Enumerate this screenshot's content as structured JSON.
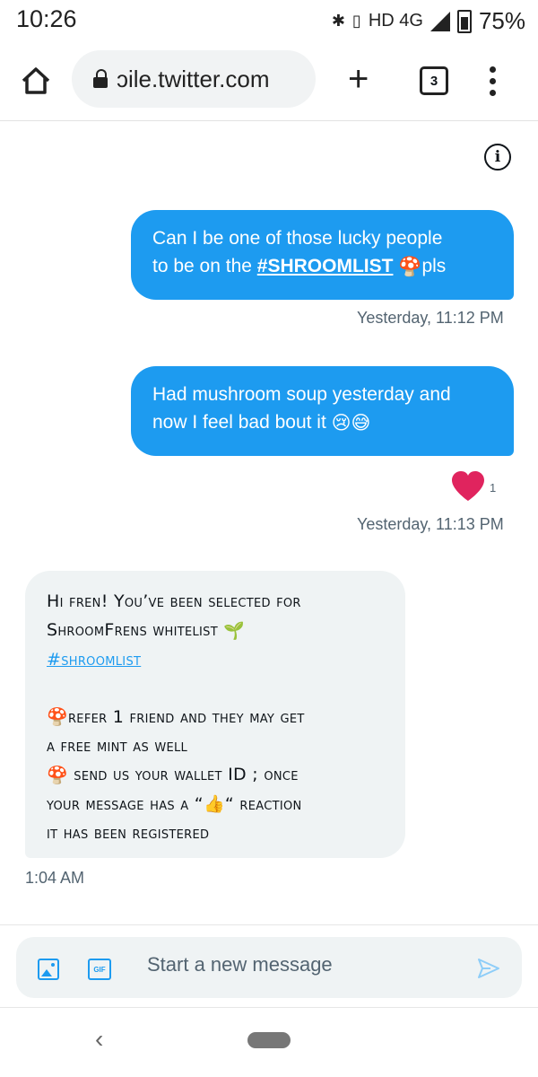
{
  "status_bar": {
    "time": "10:26",
    "network": "HD 4G",
    "battery": "75%"
  },
  "browser": {
    "url": "ɔile.twitter.com",
    "tab_count": "3"
  },
  "messages": [
    {
      "direction": "outgoing",
      "line1": "Can I be one of those lucky people",
      "line2_prefix": "to be on the ",
      "hashtag": "#SHROOMLIST",
      "emoji": "🍄",
      "line2_suffix": "pls",
      "timestamp": "Yesterday, 11:12 PM"
    },
    {
      "direction": "outgoing",
      "line1": "Had mushroom soup yesterday and",
      "line2": "now I feel bad bout it",
      "emojis": "😢😅",
      "reaction": "heart",
      "reaction_count": "1",
      "timestamp": "Yesterday, 11:13 PM"
    },
    {
      "direction": "incoming",
      "greeting_line1": "Hi fren! You’ve been selected for",
      "greeting_line2": "ShroomFrens whitelist",
      "greeting_emoji": "🌱",
      "hashtag": "#shroomlist",
      "item1_emoji": "🍄",
      "item1_line1": "refer 1 friend and they may get",
      "item1_line2": "a free mint as well",
      "item2_emoji": "🍄",
      "item2_line1": " send us your wallet ID ; once",
      "item2_line2_prefix": "your message has a “",
      "item2_emoji_thumb": "👍",
      "item2_line2_suffix": "“ reaction",
      "item2_line3": "it has been registered",
      "timestamp": "1:04 AM"
    }
  ],
  "composer": {
    "placeholder": "Start a new message",
    "gif_label": "GIF"
  },
  "colors": {
    "accent": "#1d9bf0",
    "incoming_bubble": "#eff3f4",
    "heart": "#e0245e"
  }
}
